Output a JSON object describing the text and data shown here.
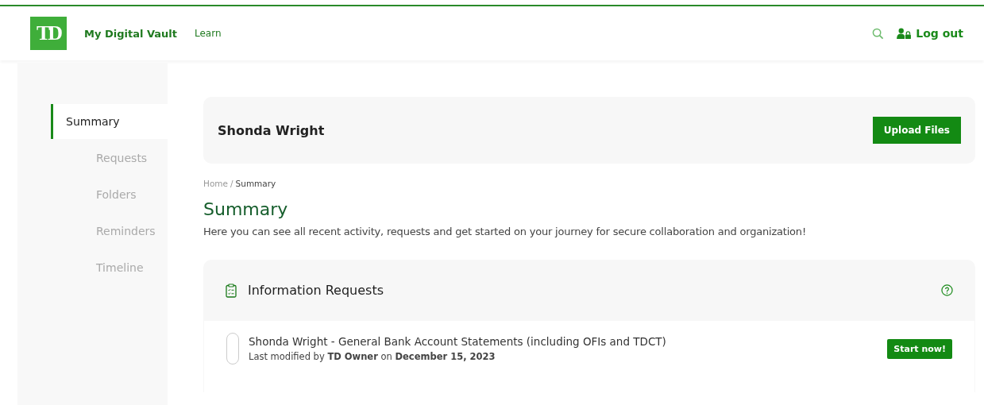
{
  "header": {
    "logo": "TD",
    "app_name": "My Digital Vault",
    "nav": [
      "Learn"
    ],
    "logout": "Log out"
  },
  "sidebar": {
    "items": [
      {
        "label": "Summary",
        "selected": true
      },
      {
        "label": "Requests",
        "selected": false
      },
      {
        "label": "Folders",
        "selected": false
      },
      {
        "label": "Reminders",
        "selected": false
      },
      {
        "label": "Timeline",
        "selected": false
      }
    ]
  },
  "profile": {
    "name": "Shonda Wright",
    "upload_button": "Upload Files"
  },
  "breadcrumb": [
    {
      "label": "Home",
      "selected": false
    },
    {
      "label": "Summary",
      "selected": true
    }
  ],
  "breadcrumb_separator": "/",
  "page_title": "Summary",
  "intro": "Here you can see all recent activity, requests and get started on your journey for secure collaboration and organization!",
  "requests": {
    "title": "Information Requests",
    "items": [
      {
        "title": "Shonda Wright - General Bank Account Statements (including OFIs and TDCT)",
        "meta": "Last modified by **TD Owner** on **December 15, 2023**",
        "checked": false,
        "action": "Start now!"
      }
    ]
  }
}
